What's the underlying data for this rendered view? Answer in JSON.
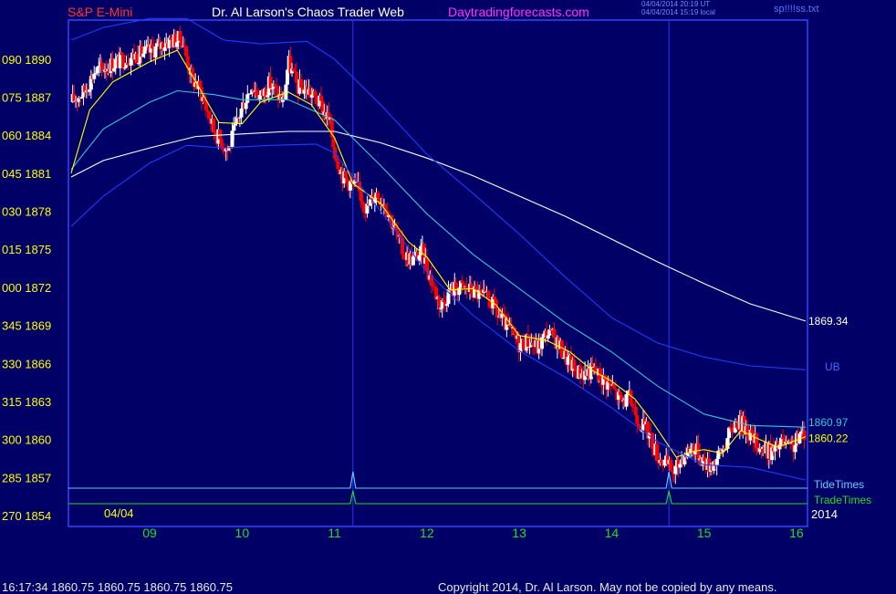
{
  "header": {
    "symbol": "S&P E-Mini",
    "title": "Dr. Al Larson's Chaos Trader Web",
    "site": "Daytradingforecasts.com",
    "time_utc": "04/04/2014 20:19 UT",
    "time_local": "04/04/2014 15:19 local",
    "file": "sp!!!!ss.txt"
  },
  "footer": {
    "quote": "16:17:34  1860.75 1860.75 1860.75 1860.75",
    "copyright": "Copyright 2014, Dr. Al Larson. May not be copied by any means."
  },
  "colors": {
    "background": "#000066",
    "plot_border": "#3344ff",
    "bull_candle": "#ffffff",
    "bear_candle": "#ff0000",
    "yellow": "#ffff00",
    "cyan": "#33c8d8",
    "white_line": "#ffffff",
    "blue_band": "#1f3cff",
    "tide": "#66ccff",
    "trade": "#22dd22",
    "x_label": "#22dd22",
    "y_label": "#ffff00"
  },
  "chart_data": {
    "type": "candlestick",
    "title": "S&P E-Mini",
    "date_label": "04/04",
    "year_label": "2014",
    "x_axis": {
      "unit": "hour",
      "range": [
        8.15,
        16.1
      ],
      "ticks": [
        "09",
        "10",
        "11",
        "12",
        "13",
        "14",
        "15",
        "16"
      ]
    },
    "y_axis": {
      "range": [
        1854,
        1892
      ],
      "ticks": [
        {
          "left": "090",
          "value": 1890
        },
        {
          "left": "075",
          "value": 1887
        },
        {
          "left": "060",
          "value": 1884
        },
        {
          "left": "045",
          "value": 1881
        },
        {
          "left": "030",
          "value": 1878
        },
        {
          "left": "015",
          "value": 1875
        },
        {
          "left": "000",
          "value": 1872
        },
        {
          "left": "345",
          "value": 1869
        },
        {
          "left": "330",
          "value": 1866
        },
        {
          "left": "315",
          "value": 1863
        },
        {
          "left": "300",
          "value": 1860
        },
        {
          "left": "285",
          "value": 1857
        },
        {
          "left": "270",
          "value": 1854
        }
      ]
    },
    "price_path": [
      [
        8.15,
        1886.6
      ],
      [
        8.3,
        1887.5
      ],
      [
        8.4,
        1889.0
      ],
      [
        8.55,
        1889.5
      ],
      [
        8.8,
        1890.2
      ],
      [
        9.0,
        1890.6
      ],
      [
        9.2,
        1891.4
      ],
      [
        9.35,
        1891.6
      ],
      [
        9.45,
        1888.6
      ],
      [
        9.55,
        1887.5
      ],
      [
        9.7,
        1884.3
      ],
      [
        9.85,
        1882.8
      ],
      [
        10.0,
        1886.2
      ],
      [
        10.1,
        1888.0
      ],
      [
        10.2,
        1887.0
      ],
      [
        10.3,
        1888.1
      ],
      [
        10.45,
        1886.6
      ],
      [
        10.5,
        1889.8
      ],
      [
        10.6,
        1887.8
      ],
      [
        10.7,
        1887.6
      ],
      [
        10.85,
        1886.4
      ],
      [
        10.95,
        1885.0
      ],
      [
        11.0,
        1882.8
      ],
      [
        11.1,
        1880.6
      ],
      [
        11.25,
        1879.8
      ],
      [
        11.35,
        1878.2
      ],
      [
        11.45,
        1879.5
      ],
      [
        11.55,
        1878.6
      ],
      [
        11.65,
        1876.6
      ],
      [
        11.75,
        1874.6
      ],
      [
        11.85,
        1874.2
      ],
      [
        11.95,
        1874.8
      ],
      [
        12.05,
        1872.5
      ],
      [
        12.15,
        1870.5
      ],
      [
        12.25,
        1871.8
      ],
      [
        12.35,
        1872.0
      ],
      [
        12.45,
        1871.8
      ],
      [
        12.55,
        1871.5
      ],
      [
        12.7,
        1870.8
      ],
      [
        12.8,
        1869.5
      ],
      [
        12.9,
        1868.6
      ],
      [
        13.0,
        1867.5
      ],
      [
        13.1,
        1867.8
      ],
      [
        13.2,
        1867.2
      ],
      [
        13.3,
        1868.5
      ],
      [
        13.4,
        1867.8
      ],
      [
        13.5,
        1866.5
      ],
      [
        13.6,
        1865.5
      ],
      [
        13.7,
        1865.2
      ],
      [
        13.8,
        1865.5
      ],
      [
        13.9,
        1864.8
      ],
      [
        14.0,
        1864.2
      ],
      [
        14.1,
        1863.0
      ],
      [
        14.2,
        1863.2
      ],
      [
        14.3,
        1861.5
      ],
      [
        14.4,
        1860.5
      ],
      [
        14.5,
        1858.7
      ],
      [
        14.6,
        1858.0
      ],
      [
        14.68,
        1857.4
      ],
      [
        14.78,
        1858.8
      ],
      [
        14.88,
        1859.5
      ],
      [
        14.97,
        1858.6
      ],
      [
        15.05,
        1857.9
      ],
      [
        15.15,
        1858.5
      ],
      [
        15.25,
        1860.0
      ],
      [
        15.35,
        1861.5
      ],
      [
        15.45,
        1861.0
      ],
      [
        15.55,
        1859.8
      ],
      [
        15.65,
        1859.2
      ],
      [
        15.75,
        1859.0
      ],
      [
        15.85,
        1859.8
      ],
      [
        15.93,
        1859.2
      ],
      [
        16.0,
        1859.8
      ],
      [
        16.1,
        1860.75
      ]
    ],
    "indicators": [
      {
        "label": "1869.34",
        "color": "#ffffff",
        "type": "slow average",
        "points": [
          [
            8.15,
            1880.7
          ],
          [
            8.5,
            1882.0
          ],
          [
            9.0,
            1883.0
          ],
          [
            9.5,
            1883.9
          ],
          [
            10.0,
            1884.1
          ],
          [
            10.5,
            1884.3
          ],
          [
            11.0,
            1884.3
          ],
          [
            11.5,
            1883.4
          ],
          [
            12.0,
            1882.2
          ],
          [
            12.5,
            1880.8
          ],
          [
            13.0,
            1879.2
          ],
          [
            13.5,
            1877.6
          ],
          [
            14.0,
            1875.8
          ],
          [
            14.5,
            1874.0
          ],
          [
            15.0,
            1872.3
          ],
          [
            15.5,
            1870.7
          ],
          [
            16.1,
            1869.34
          ]
        ]
      },
      {
        "label": "",
        "color": "#33c8d8",
        "type": "medium average",
        "points": [
          [
            8.15,
            1881.3
          ],
          [
            8.5,
            1884.5
          ],
          [
            9.0,
            1886.6
          ],
          [
            9.3,
            1887.5
          ],
          [
            9.7,
            1887.2
          ],
          [
            10.0,
            1886.8
          ],
          [
            10.5,
            1886.8
          ],
          [
            11.0,
            1885.2
          ],
          [
            11.5,
            1881.6
          ],
          [
            12.0,
            1877.8
          ],
          [
            12.5,
            1874.6
          ],
          [
            13.0,
            1871.9
          ],
          [
            13.5,
            1869.2
          ],
          [
            14.0,
            1866.9
          ],
          [
            14.5,
            1864.2
          ],
          [
            15.0,
            1862.0
          ],
          [
            15.5,
            1861.1
          ],
          [
            16.1,
            1860.97
          ]
        ]
      },
      {
        "label": "1860.22",
        "color": "#ffff00",
        "type": "fast average",
        "points": [
          [
            8.15,
            1881.0
          ],
          [
            8.35,
            1886.0
          ],
          [
            8.6,
            1888.2
          ],
          [
            9.0,
            1889.8
          ],
          [
            9.3,
            1890.7
          ],
          [
            9.5,
            1888.2
          ],
          [
            9.75,
            1885.0
          ],
          [
            10.0,
            1884.9
          ],
          [
            10.2,
            1886.6
          ],
          [
            10.5,
            1887.4
          ],
          [
            10.75,
            1886.4
          ],
          [
            11.0,
            1883.8
          ],
          [
            11.2,
            1880.2
          ],
          [
            11.5,
            1878.6
          ],
          [
            11.8,
            1875.6
          ],
          [
            12.0,
            1874.4
          ],
          [
            12.25,
            1871.8
          ],
          [
            12.5,
            1871.9
          ],
          [
            12.75,
            1870.6
          ],
          [
            13.0,
            1868.2
          ],
          [
            13.3,
            1867.8
          ],
          [
            13.55,
            1866.9
          ],
          [
            13.8,
            1865.4
          ],
          [
            14.0,
            1864.6
          ],
          [
            14.25,
            1863.2
          ],
          [
            14.45,
            1861.3
          ],
          [
            14.7,
            1858.6
          ],
          [
            14.85,
            1859.0
          ],
          [
            15.0,
            1859.2
          ],
          [
            15.2,
            1858.9
          ],
          [
            15.4,
            1860.7
          ],
          [
            15.6,
            1860.0
          ],
          [
            15.8,
            1859.4
          ],
          [
            16.1,
            1860.22
          ]
        ]
      },
      {
        "label": "UB",
        "color": "#1f3cff",
        "type": "upper band",
        "points": [
          [
            8.15,
            1891.5
          ],
          [
            8.5,
            1892.5
          ],
          [
            9.0,
            1893.2
          ],
          [
            9.4,
            1893.2
          ],
          [
            9.8,
            1891.5
          ],
          [
            10.2,
            1891.2
          ],
          [
            10.7,
            1891.4
          ],
          [
            11.0,
            1890.0
          ],
          [
            11.5,
            1886.4
          ],
          [
            12.0,
            1882.5
          ],
          [
            12.5,
            1879.4
          ],
          [
            13.0,
            1876.2
          ],
          [
            13.5,
            1872.8
          ],
          [
            14.0,
            1869.6
          ],
          [
            14.5,
            1867.6
          ],
          [
            15.0,
            1866.5
          ],
          [
            15.5,
            1865.8
          ],
          [
            16.1,
            1865.5
          ]
        ]
      },
      {
        "label": "",
        "color": "#1f3cff",
        "type": "lower band",
        "points": [
          [
            8.15,
            1876.8
          ],
          [
            8.5,
            1879.2
          ],
          [
            9.0,
            1881.8
          ],
          [
            9.4,
            1883.2
          ],
          [
            9.8,
            1883.0
          ],
          [
            10.3,
            1883.2
          ],
          [
            10.8,
            1883.3
          ],
          [
            11.0,
            1882.6
          ],
          [
            11.5,
            1878.0
          ],
          [
            12.0,
            1873.2
          ],
          [
            12.5,
            1869.8
          ],
          [
            13.0,
            1867.0
          ],
          [
            13.5,
            1864.9
          ],
          [
            14.0,
            1862.5
          ],
          [
            14.5,
            1859.8
          ],
          [
            15.0,
            1858.0
          ],
          [
            15.5,
            1857.8
          ],
          [
            16.1,
            1856.8
          ]
        ]
      }
    ],
    "time_lines": [
      11.2,
      14.62
    ],
    "tide_times": {
      "label": "TideTimes",
      "spikes": [
        11.2,
        14.62
      ]
    },
    "trade_times": {
      "label": "TradeTimes",
      "spikes": [
        11.2,
        14.62
      ]
    }
  }
}
